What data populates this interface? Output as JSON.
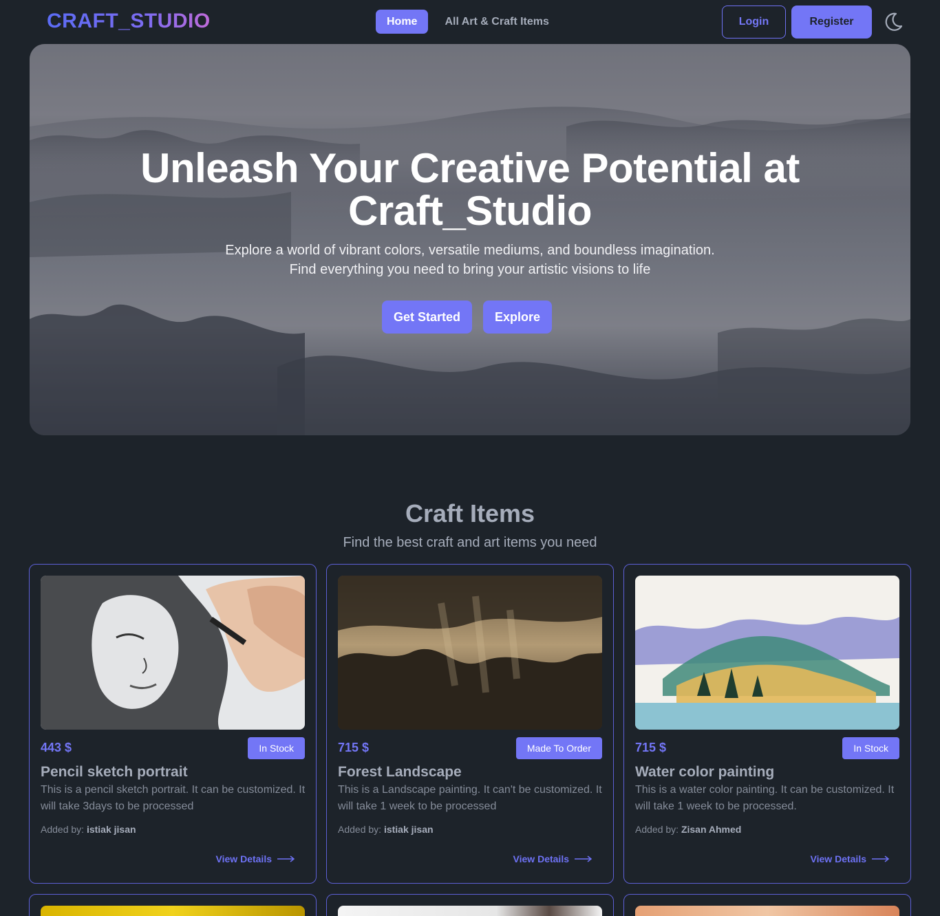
{
  "navbar": {
    "logo": "CRAFT_STUDIO",
    "links": [
      {
        "label": "Home",
        "active": true
      },
      {
        "label": "All Art & Craft Items",
        "active": false
      }
    ],
    "login_label": "Login",
    "register_label": "Register",
    "theme_icon": "moon-icon"
  },
  "hero": {
    "title": "Unleash Your Creative Potential at Craft_Studio",
    "subtitle_line1": "Explore a world of vibrant colors, versatile mediums, and boundless imagination.",
    "subtitle_line2": "Find everything you need to bring your artistic visions to life",
    "get_started_label": "Get Started",
    "explore_label": "Explore"
  },
  "section": {
    "title": "Craft Items",
    "subtitle": "Find the best craft and art items you need"
  },
  "items": [
    {
      "price": "443 $",
      "status": "In Stock",
      "name": "Pencil sketch portrait",
      "description": "This is a pencil sketch portrait. It can be customized. It will take 3days to be processed",
      "added_by_label": "Added by:",
      "added_by": "istiak jisan",
      "view_details_label": "View Details"
    },
    {
      "price": "715 $",
      "status": "Made To Order",
      "name": "Forest Landscape",
      "description": "This is a Landscape painting. It can't be customized. It will take 1 week to be processed",
      "added_by_label": "Added by:",
      "added_by": "istiak jisan",
      "view_details_label": "View Details"
    },
    {
      "price": "715 $",
      "status": "In Stock",
      "name": "Water color painting",
      "description": "This is a water color painting. It can be customized. It will take 1 week to be processed.",
      "added_by_label": "Added by:",
      "added_by": "Zisan Ahmed",
      "view_details_label": "View Details"
    }
  ],
  "colors": {
    "accent": "#7376f6",
    "background": "#1d232a",
    "text": "#a6adbb"
  }
}
